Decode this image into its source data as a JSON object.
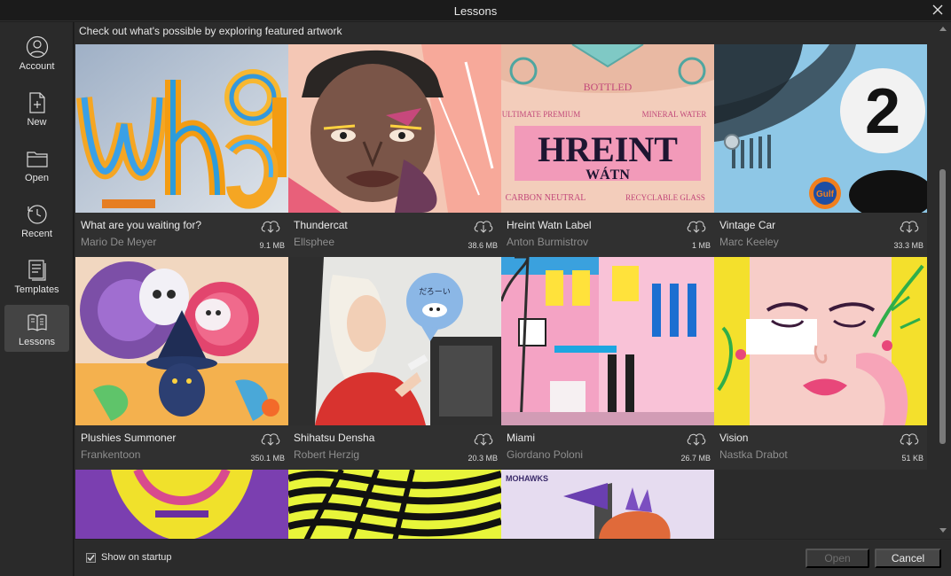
{
  "window": {
    "title": "Lessons"
  },
  "sidebar": {
    "items": [
      {
        "label": "Account",
        "icon": "account-icon"
      },
      {
        "label": "New",
        "icon": "new-file-icon"
      },
      {
        "label": "Open",
        "icon": "folder-icon"
      },
      {
        "label": "Recent",
        "icon": "clock-icon"
      },
      {
        "label": "Templates",
        "icon": "templates-icon"
      },
      {
        "label": "Lessons",
        "icon": "book-icon",
        "active": true
      }
    ]
  },
  "main": {
    "header": "Check out what's possible by exploring featured artwork",
    "cards": [
      {
        "title": "What are you waiting for?",
        "author": "Mario De Meyer",
        "size": "9.1 MB"
      },
      {
        "title": "Thundercat",
        "author": "Ellsphee",
        "size": "38.6 MB"
      },
      {
        "title": "Hreint Watn Label",
        "author": "Anton Burmistrov",
        "size": "1 MB"
      },
      {
        "title": "Vintage Car",
        "author": "Marc Keeley",
        "size": "33.3 MB"
      },
      {
        "title": "Plushies Summoner",
        "author": "Frankentoon",
        "size": "350.1 MB"
      },
      {
        "title": "Shihatsu Densha",
        "author": "Robert Herzig",
        "size": "20.3 MB"
      },
      {
        "title": "Miami",
        "author": "Giordano Poloni",
        "size": "26.7 MB"
      },
      {
        "title": "Vision",
        "author": "Nastka Drabot",
        "size": "51 KB"
      }
    ],
    "art_text": {
      "wait": "Wha",
      "bottled": "BOTTLED",
      "hreint": "HREINT",
      "watn": "WÁTN",
      "ultimate": "ULTIMATE PREMIUM",
      "mineral": "MINERAL WATER",
      "carbon": "CARBON NEUTRAL",
      "glass": "RECYCLABLE GLASS",
      "car_number": "2",
      "gulf": "Gulf",
      "bubble": "だろーい",
      "mohawks": "MOHAWKS"
    }
  },
  "footer": {
    "startup_label": "Show on startup",
    "startup_checked": true,
    "open_label": "Open",
    "cancel_label": "Cancel"
  }
}
